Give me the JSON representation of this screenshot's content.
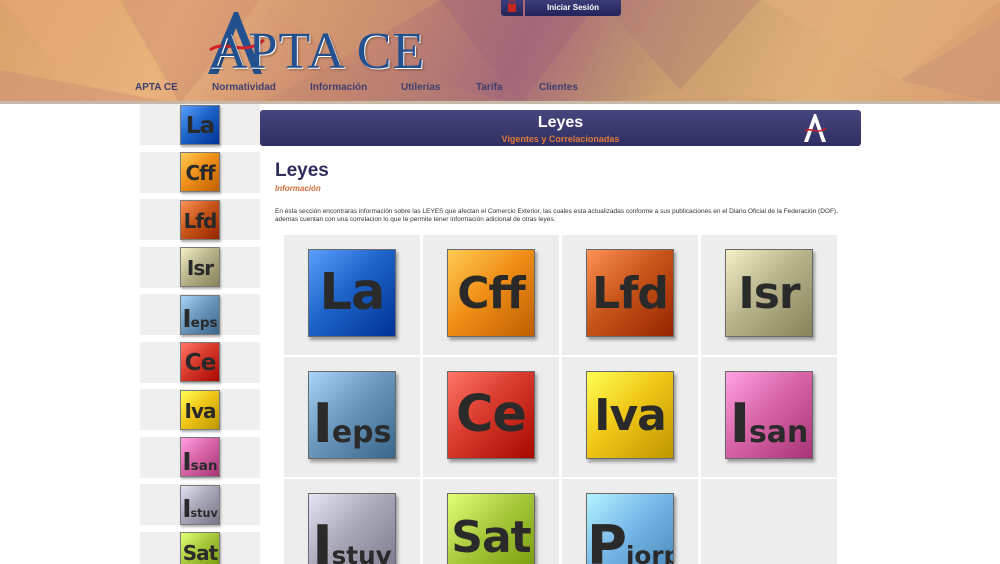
{
  "header": {
    "logo_text": "APTA CE",
    "login_label": "Iniciar Sesión",
    "nav": [
      "APTA CE",
      "Normatividad",
      "Información",
      "Utilerías",
      "Tarifa",
      "Clientes"
    ]
  },
  "title_bar": {
    "title": "Leyes",
    "subtitle": "Vigentes y Correlacionadas"
  },
  "content": {
    "heading": "Leyes",
    "subheading": "Información",
    "description": "En ésta sección encontraras información sobre las LEYES que afectan el Comercio Exterior, las cuales esta actualizadas conforme a sus publicaciones en el Diario Oficial de la Federación (DOF), ademas cuentan con una correlacion lo que te permite tener información adicional de otras leyes."
  },
  "laws": [
    {
      "big": "La",
      "small": "",
      "color": "#1d64c8"
    },
    {
      "big": "Cff",
      "small": "",
      "color": "#f09018"
    },
    {
      "big": "Lfd",
      "small": "",
      "color": "#c8561a"
    },
    {
      "big": "Isr",
      "small": "",
      "color": "#b8b48c"
    },
    {
      "big": "I",
      "small": "eps",
      "color": "#6c98be"
    },
    {
      "big": "Ce",
      "small": "",
      "color": "#d83a2c"
    },
    {
      "big": "Iva",
      "small": "",
      "color": "#f0c818"
    },
    {
      "big": "I",
      "small": "san",
      "color": "#d866a8"
    },
    {
      "big": "I",
      "small": "stuv",
      "color": "#a8a8b8"
    },
    {
      "big": "Sat",
      "small": "",
      "color": "#a8c83c"
    },
    {
      "big": "P",
      "small": "iorpi",
      "color": "#78b8e8"
    }
  ],
  "sidebar_laws": [
    {
      "big": "La",
      "small": "",
      "color": "#1d64c8"
    },
    {
      "big": "Cff",
      "small": "",
      "color": "#f09018"
    },
    {
      "big": "Lfd",
      "small": "",
      "color": "#c8561a"
    },
    {
      "big": "Isr",
      "small": "",
      "color": "#b8b48c"
    },
    {
      "big": "I",
      "small": "eps",
      "color": "#6c98be"
    },
    {
      "big": "Ce",
      "small": "",
      "color": "#d83a2c"
    },
    {
      "big": "Iva",
      "small": "",
      "color": "#f0c818"
    },
    {
      "big": "I",
      "small": "san",
      "color": "#d866a8"
    },
    {
      "big": "I",
      "small": "stuv",
      "color": "#a8a8b8"
    },
    {
      "big": "Sat",
      "small": "",
      "color": "#a8c83c"
    }
  ]
}
